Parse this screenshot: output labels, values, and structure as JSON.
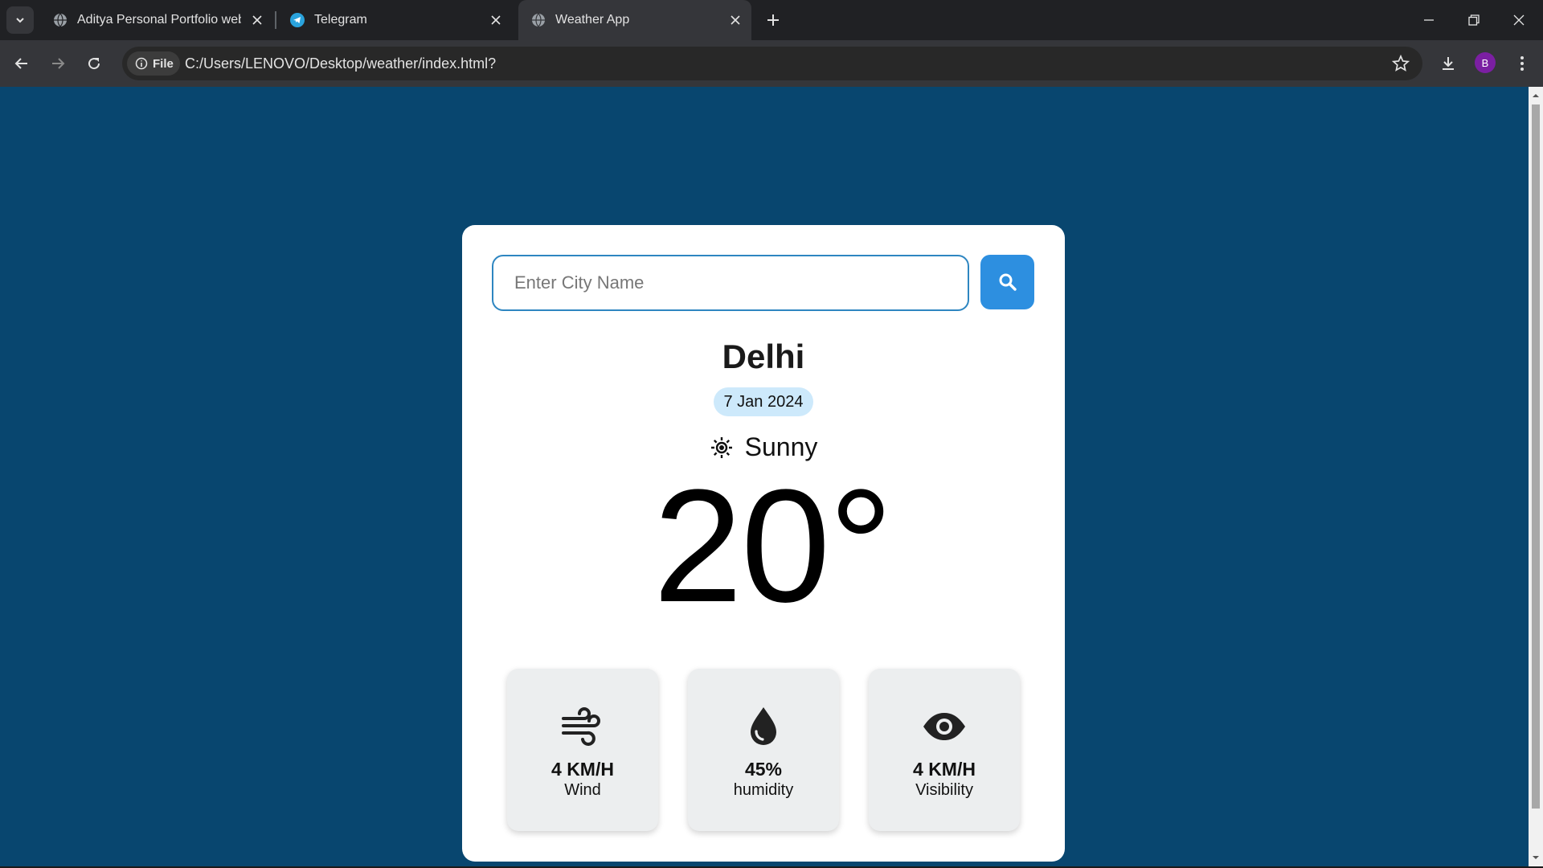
{
  "browser": {
    "tabs": [
      {
        "title": "Aditya Personal Portfolio websit",
        "active": false
      },
      {
        "title": "Telegram",
        "active": false
      },
      {
        "title": "Weather App",
        "active": true
      }
    ],
    "address": {
      "scheme_label": "File",
      "url": "C:/Users/LENOVO/Desktop/weather/index.html?"
    },
    "profile_initial": "B"
  },
  "app": {
    "search": {
      "placeholder": "Enter City Name",
      "value": ""
    },
    "city": "Delhi",
    "date": "7 Jan 2024",
    "condition": {
      "label": "Sunny",
      "icon": "sun-icon"
    },
    "temperature": "20°",
    "stats": [
      {
        "value": "4 KM/H",
        "label": "Wind",
        "icon": "wind-icon"
      },
      {
        "value": "45%",
        "label": "humidity",
        "icon": "water-drop-icon"
      },
      {
        "value": "4 KM/H",
        "label": "Visibility",
        "icon": "eye-icon"
      }
    ]
  },
  "colors": {
    "page_background": "#08466f",
    "accent": "#2d8fe0",
    "date_badge": "#cde9fb",
    "stat_card": "#eceeef"
  }
}
